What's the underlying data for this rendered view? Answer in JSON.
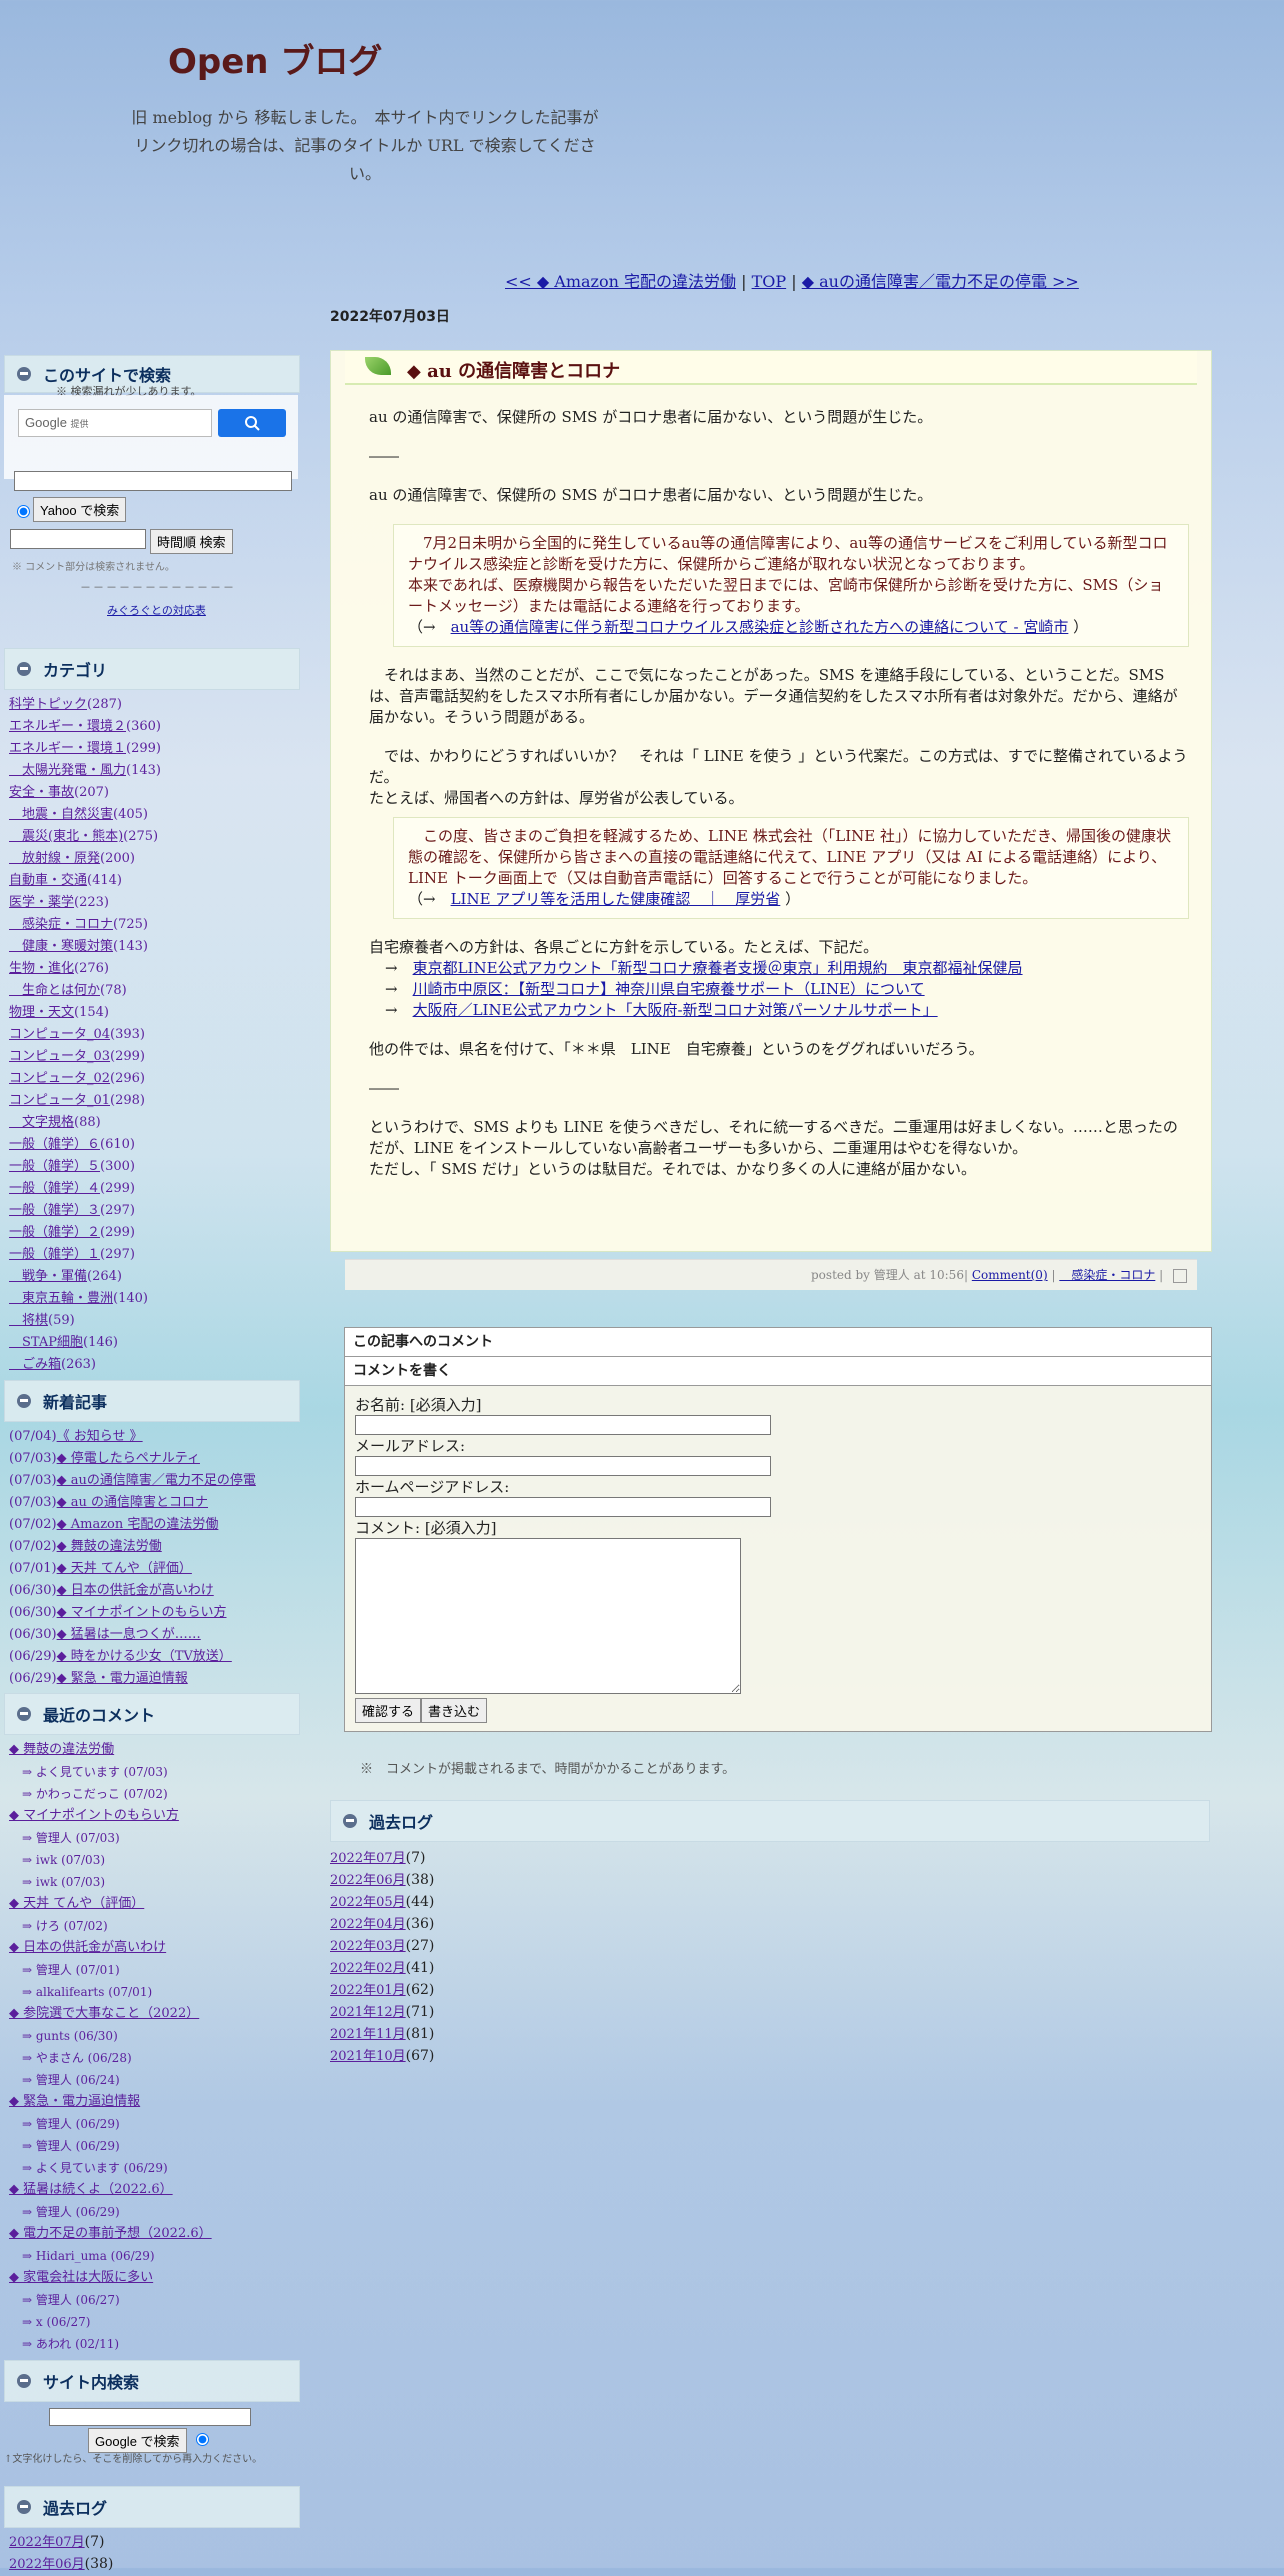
{
  "site": {
    "title": "Open ブログ",
    "desc1": "旧 meblog から 移転しました。　本サイト内でリンクした記事が",
    "desc2": "リンク切れの場合は、記事のタイトルか URL で検索してください。"
  },
  "nav": {
    "prev": "<< ◆ Amazon 宅配の違法労働",
    "sep1": " | ",
    "top": "TOP",
    "sep2": " | ",
    "next": "◆ auの通信障害／電力不足の停電 >>"
  },
  "date": "2022年07月03日",
  "search": {
    "head": "このサイトで検索",
    "note": "※ 検索漏れが少しあります。",
    "google_logo": "Google",
    "google_sub": "提供",
    "yahoo_btn": "Yahoo で検索",
    "time_btn": "時間順 検索",
    "hint": "※ コメント部分は検索されません。",
    "dashes": "－－－－－－－－－－－－",
    "link": "みぐろぐとの対応表"
  },
  "categories": {
    "head": "カテゴリ",
    "items": [
      {
        "name": "科学トピック",
        "count": "(287)"
      },
      {
        "name": "エネルギー・環境２",
        "count": "(360)"
      },
      {
        "name": "エネルギー・環境１",
        "count": "(299)"
      },
      {
        "name": "　太陽光発電・風力",
        "count": "(143)"
      },
      {
        "name": "安全・事故",
        "count": "(207)"
      },
      {
        "name": "　地震・自然災害",
        "count": "(405)"
      },
      {
        "name": "　震災(東北・熊本)",
        "count": "(275)"
      },
      {
        "name": "　放射線・原発",
        "count": "(200)"
      },
      {
        "name": "自動車・交通",
        "count": "(414)"
      },
      {
        "name": "医学・薬学",
        "count": "(223)"
      },
      {
        "name": "　感染症・コロナ",
        "count": "(725)"
      },
      {
        "name": "　健康・寒暖対策",
        "count": "(143)"
      },
      {
        "name": "生物・進化",
        "count": "(276)"
      },
      {
        "name": "　生命とは何か",
        "count": "(78)"
      },
      {
        "name": "物理・天文",
        "count": "(154)"
      },
      {
        "name": "コンピュータ_04",
        "count": "(393)"
      },
      {
        "name": "コンピュータ_03",
        "count": "(299)"
      },
      {
        "name": "コンピュータ_02",
        "count": "(296)"
      },
      {
        "name": "コンピュータ_01",
        "count": "(298)"
      },
      {
        "name": "　文字規格",
        "count": "(88)"
      },
      {
        "name": "一般（雑学）６",
        "count": "(610)"
      },
      {
        "name": "一般（雑学）５",
        "count": "(300)"
      },
      {
        "name": "一般（雑学）４",
        "count": "(299)"
      },
      {
        "name": "一般（雑学）３",
        "count": "(297)"
      },
      {
        "name": "一般（雑学）２",
        "count": "(299)"
      },
      {
        "name": "一般（雑学）１",
        "count": "(297)"
      },
      {
        "name": "　戦争・軍備",
        "count": "(264)"
      },
      {
        "name": "　東京五輪・豊洲",
        "count": "(140)"
      },
      {
        "name": "　将棋",
        "count": "(59)"
      },
      {
        "name": "　STAP細胞",
        "count": "(146)"
      },
      {
        "name": "　ごみ箱",
        "count": "(263)"
      }
    ]
  },
  "recent": {
    "head": "新着記事",
    "items": [
      {
        "date": "(07/04)",
        "title": "《 お知らせ 》"
      },
      {
        "date": "(07/03)",
        "title": "◆ 停電したらペナルティ"
      },
      {
        "date": "(07/03)",
        "title": "◆ auの通信障害／電力不足の停電"
      },
      {
        "date": "(07/03)",
        "title": "◆ au の通信障害とコロナ"
      },
      {
        "date": "(07/02)",
        "title": "◆ Amazon 宅配の違法労働"
      },
      {
        "date": "(07/02)",
        "title": "◆ 舞鼓の違法労働"
      },
      {
        "date": "(07/01)",
        "title": "◆ 天丼 てんや（評価）"
      },
      {
        "date": "(06/30)",
        "title": "◆ 日本の供託金が高いわけ"
      },
      {
        "date": "(06/30)",
        "title": "◆ マイナポイントのもらい方"
      },
      {
        "date": "(06/30)",
        "title": "◆ 猛暑は一息つくが……"
      },
      {
        "date": "(06/29)",
        "title": "◆ 時をかける少女（TV放送）"
      },
      {
        "date": "(06/29)",
        "title": "◆ 緊急・電力逼迫情報"
      }
    ]
  },
  "comments_side": {
    "head": "最近のコメント",
    "groups": [
      {
        "title": "◆ 舞鼓の違法労働",
        "items": [
          "⇒ よく見ています (07/03)",
          "⇒ かわっこだっこ (07/02)"
        ]
      },
      {
        "title": "◆ マイナポイントのもらい方",
        "items": [
          "⇒ 管理人 (07/03)",
          "⇒ iwk (07/03)",
          "⇒ iwk (07/03)"
        ]
      },
      {
        "title": "◆ 天丼 てんや（評価）",
        "items": [
          "⇒ けろ (07/02)"
        ]
      },
      {
        "title": "◆ 日本の供託金が高いわけ",
        "items": [
          "⇒ 管理人 (07/01)",
          "⇒ alkalifearts (07/01)"
        ]
      },
      {
        "title": "◆ 参院選で大事なこと（2022）",
        "items": [
          "⇒ gunts (06/30)",
          "⇒ やまさん (06/28)",
          "⇒ 管理人 (06/24)"
        ]
      },
      {
        "title": "◆ 緊急・電力逼迫情報",
        "items": [
          "⇒ 管理人 (06/29)",
          "⇒ 管理人 (06/29)",
          "⇒ よく見ています (06/29)"
        ]
      },
      {
        "title": "◆ 猛暑は続くよ（2022.6）",
        "items": [
          "⇒ 管理人 (06/29)"
        ]
      },
      {
        "title": "◆ 電力不足の事前予想（2022.6）",
        "items": [
          "⇒ Hidari_uma (06/29)"
        ]
      },
      {
        "title": "◆ 家電会社は大阪に多い",
        "items": [
          "⇒ 管理人 (06/27)",
          "⇒ x (06/27)",
          "⇒ あわれ (02/11)"
        ]
      }
    ]
  },
  "sitesearch": {
    "head": "サイト内検索",
    "btn": "Google で検索",
    "note": "↑文字化けしたら、そこを削除してから再入力ください。"
  },
  "archive": {
    "head": "過去ログ",
    "items": [
      {
        "m": "2022年07月",
        "c": "(7)"
      },
      {
        "m": "2022年06月",
        "c": "(38)"
      },
      {
        "m": "2022年05月",
        "c": "(44)"
      },
      {
        "m": "2022年04月",
        "c": "(36)"
      },
      {
        "m": "2022年03月",
        "c": "(27)"
      },
      {
        "m": "2022年02月",
        "c": "(41)"
      },
      {
        "m": "2022年01月",
        "c": "(62)"
      },
      {
        "m": "2021年12月",
        "c": "(71)"
      },
      {
        "m": "2021年11月",
        "c": "(81)"
      },
      {
        "m": "2021年10月",
        "c": "(67)"
      }
    ],
    "side_items": [
      {
        "m": "2022年07月",
        "c": "(7)"
      },
      {
        "m": "2022年06月",
        "c": "(38)"
      }
    ]
  },
  "article": {
    "title": "◆ au の通信障害とコロナ",
    "p1": "au の通信障害で、保健所の SMS がコロナ患者に届かない、という問題が生じた。",
    "p2": "――",
    "p3": "au の通信障害で、保健所の SMS がコロナ患者に届かない、という問題が生じた。",
    "q1a": "　7月2日未明から全国的に発生しているau等の通信障害により、au等の通信サービスをご利用している新型コロナウイルス感染症と診断を受けた方に、保健所からご連絡が取れない状況となっております。",
    "q1b": "本来であれば、医療機関から報告をいただいた翌日までには、宮崎市保健所から診断を受けた方に、SMS（ショートメッセージ）または電話による連絡を行っております。",
    "q1c_pre": "（→　",
    "q1c_link": "au等の通信障害に伴う新型コロナウイルス感染症と診断された方への連絡について - 宮崎市",
    "q1c_post": " ）",
    "p4": "それはまあ、当然のことだが、ここで気になったことがあった。SMS を連絡手段にしている、ということだ。SMS は、音声電話契約をしたスマホ所有者にしか届かない。データ通信契約をしたスマホ所有者は対象外だ。だから、連絡が届かない。そういう問題がある。",
    "p5": "では、かわりにどうすればいいか？　それは「 LINE を使う 」という代案だ。この方式は、すでに整備されているようだ。",
    "p6": "たとえば、帰国者への方針は、厚労省が公表している。",
    "q2a": "　この度、皆さまのご負担を軽減するため、LINE 株式会社（「LINE 社」）に協力していただき、帰国後の健康状態の確認を、保健所から皆さまへの直接の電話連絡に代えて、LINE アプリ（又は AI による電話連絡）により、LINE トーク画面上で（又は自動音声電話に）回答することで行うことが可能になりました。",
    "q2b_pre": "（→　",
    "q2b_link": "LINE アプリ等を活用した健康確認　｜　厚労省",
    "q2b_post": " ）",
    "p7": "自宅療養者への方針は、各県ごとに方針を示している。たとえば、下記だ。",
    "links": [
      "東京都LINE公式アカウント「新型コロナ療養者支援＠東京」利用規約　東京都福祉保健局",
      "川崎市中原区：【新型コロナ】神奈川県自宅療養サポート（LINE）について",
      "大阪府／LINE公式アカウント「大阪府-新型コロナ対策パーソナルサポート」"
    ],
    "arrow": "→　",
    "p8": "他の件では、県名を付けて、「＊＊県　LINE　自宅療養」というのをググればいいだろう。",
    "p9": "――",
    "p10": "というわけで、SMS よりも LINE を使うべきだし、それに統一するべきだ。二重運用は好ましくない。……と思ったのだが、LINE をインストールしていない高齢者ユーザーも多いから、二重運用はやむを得ないか。",
    "p11": "ただし、「 SMS だけ」というのは駄目だ。それでは、かなり多くの人に連絡が届かない。",
    "foot_pre": "posted by 管理人 at 10:56| ",
    "foot_comment": "Comment(0)",
    "foot_sep": " | ",
    "foot_cat": "　感染症・コロナ",
    "foot_end": " | "
  },
  "comment_form": {
    "head1": "この記事へのコメント",
    "head2": "コメントを書く",
    "name_label": "お名前: [必須入力]",
    "mail_label": "メールアドレス:",
    "home_label": "ホームページアドレス:",
    "comment_label": "コメント: [必須入力]",
    "confirm_btn": "確認する",
    "submit_btn": "書き込む"
  },
  "note": "※　コメントが掲載されるまで、時間がかかることがあります。"
}
